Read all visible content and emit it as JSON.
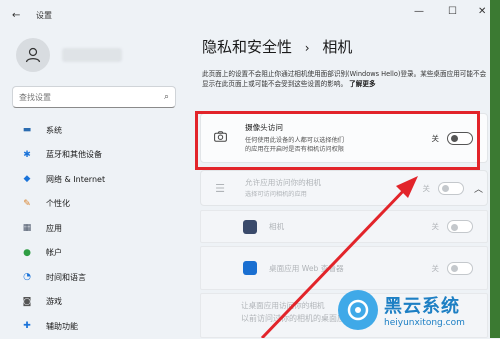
{
  "window": {
    "title": "设置"
  },
  "search": {
    "placeholder": "查找设置"
  },
  "sidebar": {
    "items": [
      {
        "label": "系统",
        "icon": "monitor-icon"
      },
      {
        "label": "蓝牙和其他设备",
        "icon": "bluetooth-icon"
      },
      {
        "label": "网络 & Internet",
        "icon": "wifi-icon"
      },
      {
        "label": "个性化",
        "icon": "brush-icon"
      },
      {
        "label": "应用",
        "icon": "apps-icon"
      },
      {
        "label": "帐户",
        "icon": "person-icon"
      },
      {
        "label": "时间和语言",
        "icon": "globe-clock-icon"
      },
      {
        "label": "游戏",
        "icon": "gamepad-icon"
      },
      {
        "label": "辅助功能",
        "icon": "accessibility-icon"
      }
    ]
  },
  "main": {
    "breadcrumb_parent": "隐私和安全性",
    "breadcrumb_sep": "›",
    "breadcrumb_current": "相机",
    "description": "此页面上的设置不会阻止你通过相机使用面部识别(Windows Hello)登录。某些桌面应用可能不会显示在此页面上或可能不会受到这些设置的影响。",
    "learn_more": "了解更多",
    "camera_access": {
      "title": "摄像头访问",
      "subtitle_line1": "任何使用此设备的人都可以选择他们",
      "subtitle_line2": "的应用在开启时是否有相机访问权限",
      "state": "关"
    },
    "app_access": {
      "title": "允许应用访问你的相机",
      "subtitle": "选择可访问相机的应用",
      "state": "关"
    },
    "apps": [
      {
        "name": "相机",
        "state": "关"
      },
      {
        "name": "桌面应用 Web 查看器",
        "state": "关"
      }
    ],
    "desktop_apps": {
      "title": "让桌面应用访问你的相机",
      "subtitle": "以前访问过你的相机的桌面应用程序"
    }
  },
  "watermark": {
    "brand": "黑云系统",
    "url": "heiyunxitong.com"
  },
  "colors": {
    "highlight": "#e2242a",
    "accent_strip": "#3b7a32",
    "watermark": "#1d7fc4"
  }
}
